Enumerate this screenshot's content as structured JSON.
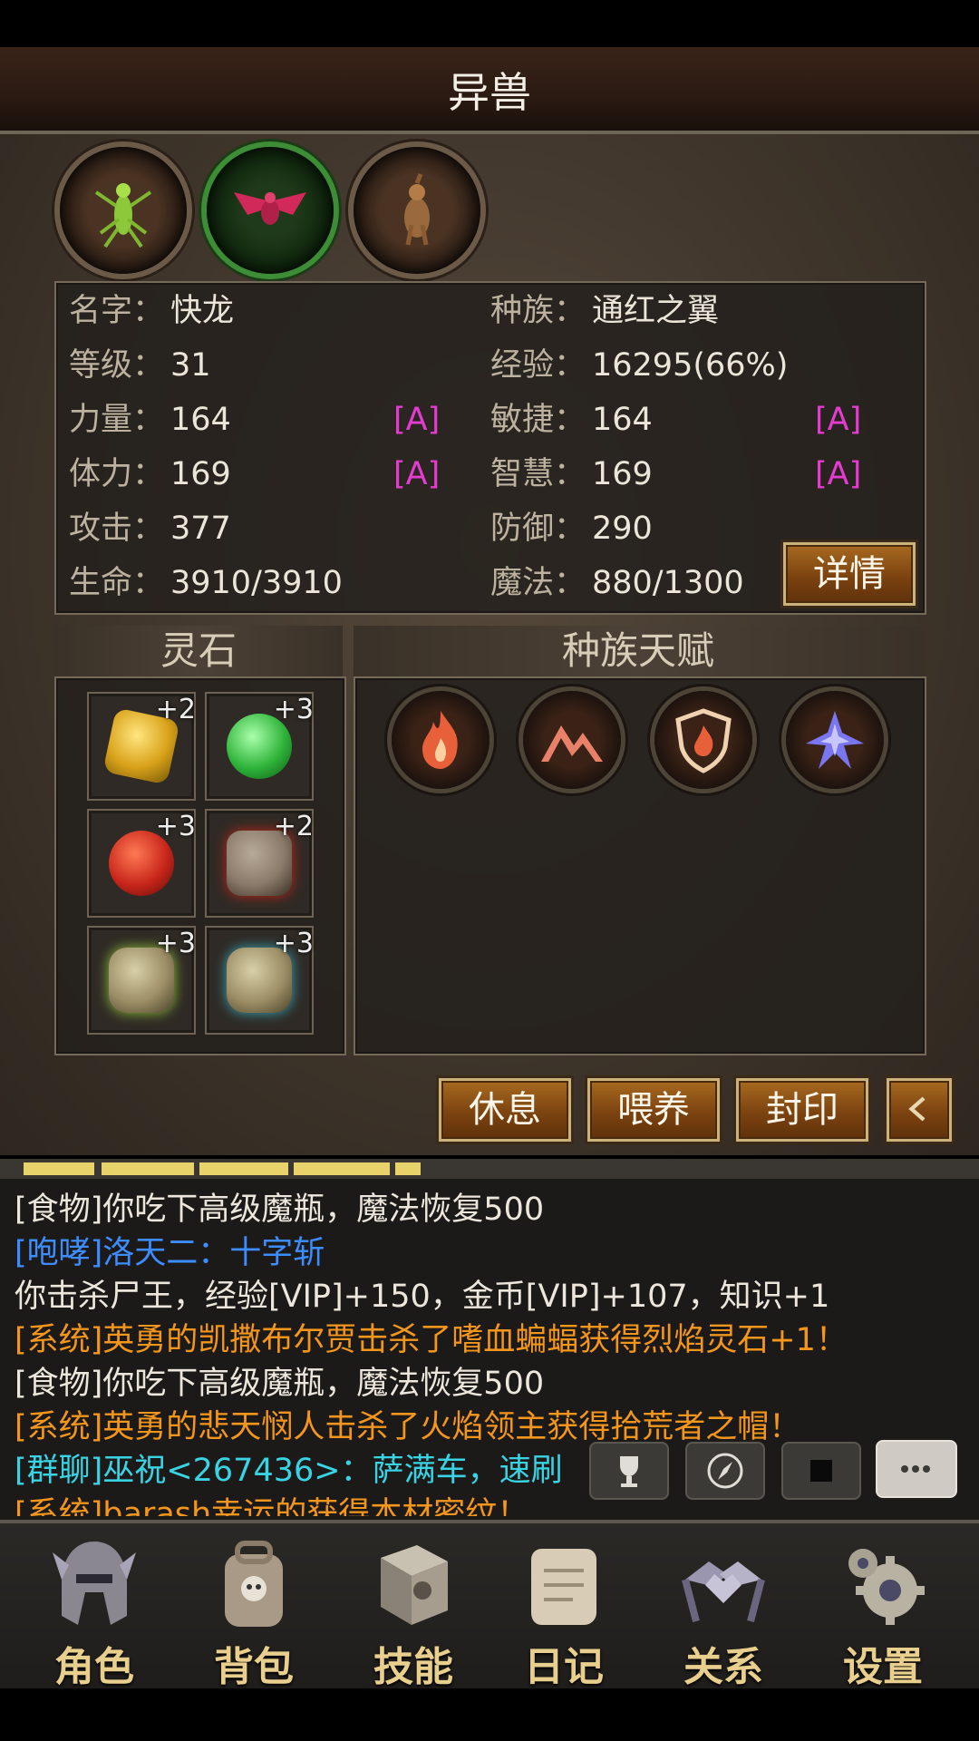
{
  "header": {
    "title": "异兽"
  },
  "pets": [
    {
      "name": "mantis"
    },
    {
      "name": "red-wing"
    },
    {
      "name": "beast"
    }
  ],
  "stats": {
    "name": {
      "label": "名字：",
      "value": "快龙"
    },
    "race": {
      "label": "种族：",
      "value": "通红之翼"
    },
    "level": {
      "label": "等级：",
      "value": "31"
    },
    "exp": {
      "label": "经验：",
      "value": "16295(66%)"
    },
    "str": {
      "label": "力量：",
      "value": "164",
      "tag": "[A]"
    },
    "agi": {
      "label": "敏捷：",
      "value": "164",
      "tag": "[A]"
    },
    "vit": {
      "label": "体力：",
      "value": "169",
      "tag": "[A]"
    },
    "wis": {
      "label": "智慧：",
      "value": "169",
      "tag": "[A]"
    },
    "atk": {
      "label": "攻击：",
      "value": "377"
    },
    "def": {
      "label": "防御：",
      "value": "290"
    },
    "hp": {
      "label": "生命：",
      "value": "3910/3910"
    },
    "mp": {
      "label": "魔法：",
      "value": "880/1300"
    },
    "detail_label": "详情"
  },
  "spirit": {
    "title": "灵石",
    "slots": [
      {
        "level": "+2",
        "color": "#d9a21a",
        "icon": "yellow-rune-icon"
      },
      {
        "level": "+3",
        "color": "#2fb33a",
        "icon": "green-orb-icon"
      },
      {
        "level": "+3",
        "color": "#c8261a",
        "icon": "red-orb-icon"
      },
      {
        "level": "+2",
        "color": "#8a7a6a",
        "icon": "red-rune-icon"
      },
      {
        "level": "+3",
        "color": "#8fbf3a",
        "icon": "green-rune-icon"
      },
      {
        "level": "+3",
        "color": "#3aa7b8",
        "icon": "blue-rune-icon"
      }
    ]
  },
  "talent": {
    "title": "种族天赋",
    "icons": [
      "fire-icon",
      "mountain-icon",
      "fire-shield-icon",
      "wing-sigil-icon"
    ]
  },
  "actions": {
    "rest": "休息",
    "feed": "喂养",
    "seal": "封印"
  },
  "chat": {
    "lines": [
      {
        "text": "[食物]你吃下高级魔瓶，魔法恢复500",
        "cls": "w"
      },
      {
        "text": "[咆哮]洛天二：十字斩",
        "cls": "b"
      },
      {
        "text": "你击杀尸王，经验[VIP]+150，金币[VIP]+107，知识+1",
        "cls": "w"
      },
      {
        "text": "[系统]英勇的凯撒布尔贾击杀了嗜血蝙蝠获得烈焰灵石+1！",
        "cls": "o"
      },
      {
        "text": "[食物]你吃下高级魔瓶，魔法恢复500",
        "cls": "w"
      },
      {
        "text": "[系统]英勇的悲天悯人击杀了火焰领主获得拾荒者之帽！",
        "cls": "o"
      },
      {
        "text": "[群聊]巫祝<267436>：萨满车，速刷",
        "cls": "c"
      },
      {
        "text": "[系统]barash幸运的获得本材密纹！",
        "cls": "o"
      }
    ]
  },
  "nav": [
    {
      "label": "角色",
      "icon": "helmet-icon"
    },
    {
      "label": "背包",
      "icon": "backpack-icon"
    },
    {
      "label": "技能",
      "icon": "skill-book-icon"
    },
    {
      "label": "日记",
      "icon": "scroll-icon"
    },
    {
      "label": "关系",
      "icon": "handshake-icon"
    },
    {
      "label": "设置",
      "icon": "gear-icon"
    }
  ]
}
